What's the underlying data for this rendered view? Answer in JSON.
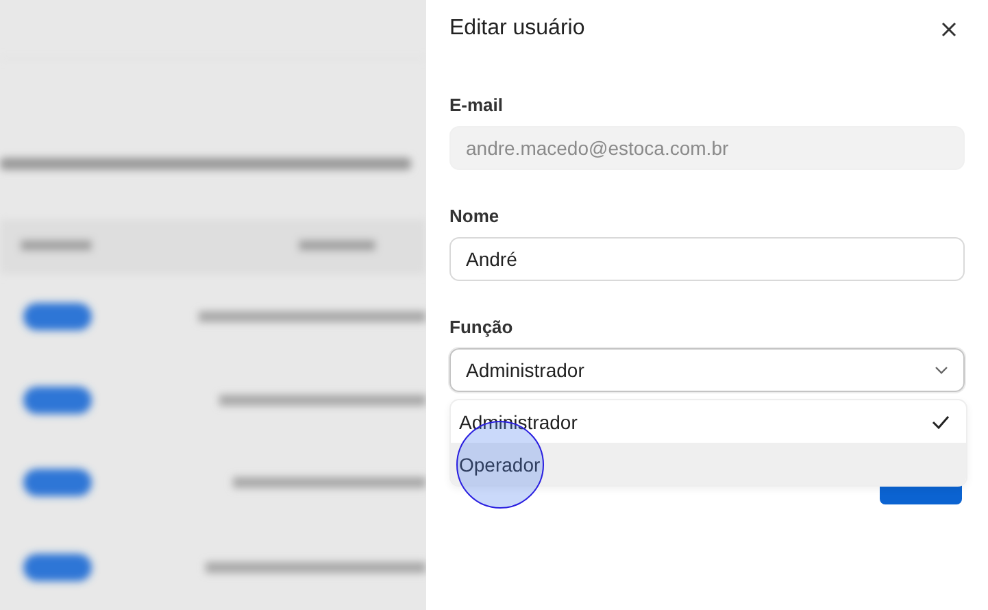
{
  "drawer": {
    "title": "Editar usuário"
  },
  "fields": [
    {
      "kind": "input",
      "label": "E-mail",
      "value": "andre.macedo@estoca.com.br",
      "disabled": true
    },
    {
      "kind": "input",
      "label": "Nome",
      "value": "André",
      "disabled": false
    },
    {
      "kind": "select",
      "label": "Função",
      "value": "Administrador",
      "expanded": true,
      "options": [
        {
          "label": "Administrador",
          "selected": true,
          "highlighted": false
        },
        {
          "label": "Operador",
          "selected": false,
          "highlighted": true
        }
      ]
    }
  ]
}
